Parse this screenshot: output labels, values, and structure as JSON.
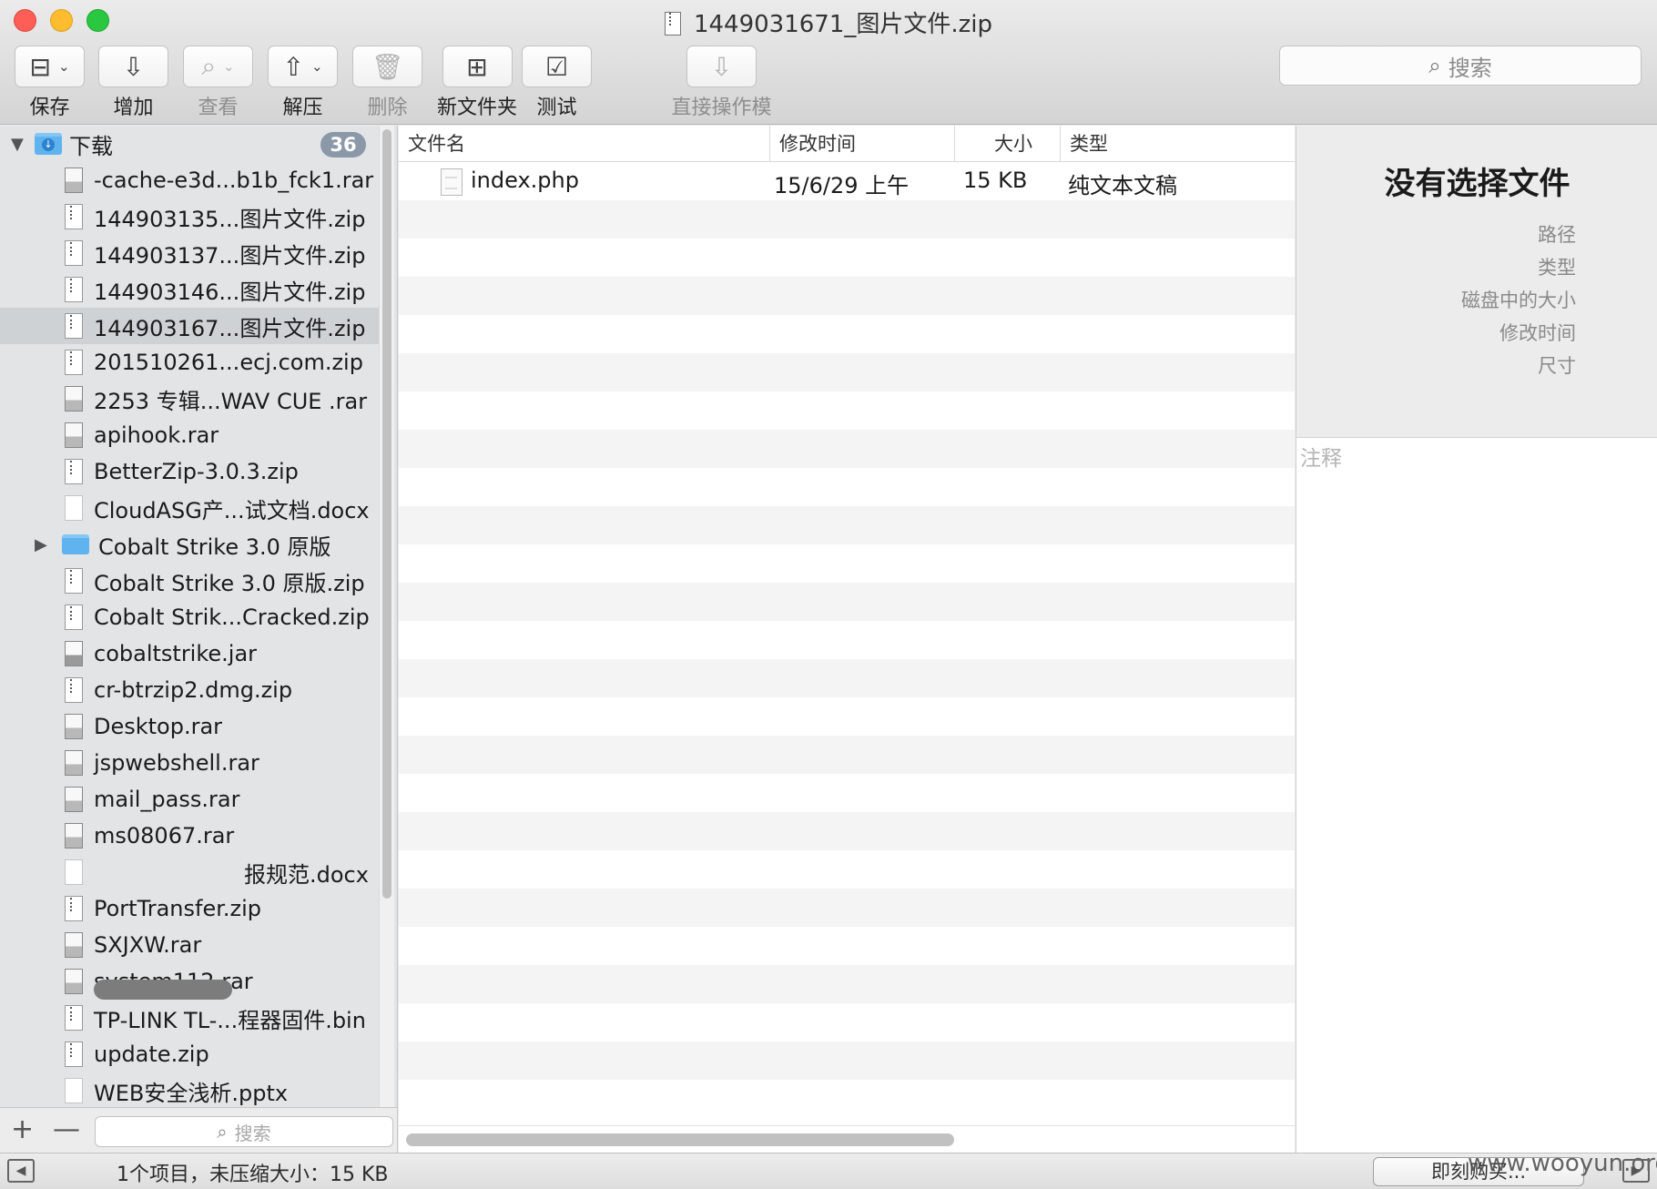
{
  "window": {
    "title": "1449031671_图片文件.zip"
  },
  "toolbar": {
    "buttons": [
      {
        "label": "保存",
        "icon": "archive-icon"
      },
      {
        "label": "增加",
        "icon": "add-box-icon"
      },
      {
        "label": "查看",
        "icon": "magnifier-icon"
      },
      {
        "label": "解压",
        "icon": "extract-icon"
      },
      {
        "label": "删除",
        "icon": "trash-icon"
      },
      {
        "label": "新文件夹",
        "icon": "new-folder-icon"
      },
      {
        "label": "测试",
        "icon": "checkmark-icon"
      },
      {
        "label": "直接操作模式",
        "icon": "direct-mode-icon"
      }
    ],
    "search_placeholder": "搜索"
  },
  "sidebar": {
    "root": {
      "label": "下载",
      "badge": "36"
    },
    "items": [
      {
        "label": "-cache-e3d...b1b_fck1.rar",
        "type": "rar"
      },
      {
        "label": "144903135...图片文件.zip",
        "type": "zip"
      },
      {
        "label": "144903137...图片文件.zip",
        "type": "zip"
      },
      {
        "label": "144903146...图片文件.zip",
        "type": "zip"
      },
      {
        "label": "144903167...图片文件.zip",
        "type": "zip",
        "selected": true
      },
      {
        "label": "201510261...ecj.com.zip",
        "type": "zip"
      },
      {
        "label": "2253 专辑...WAV CUE .rar",
        "type": "rar"
      },
      {
        "label": "apihook.rar",
        "type": "rar"
      },
      {
        "label": "BetterZip-3.0.3.zip",
        "type": "zip"
      },
      {
        "label": "CloudASG产...试文档.docx",
        "type": "doc"
      },
      {
        "label": "Cobalt Strike 3.0 原版",
        "type": "folder"
      },
      {
        "label": "Cobalt Strike 3.0 原版.zip",
        "type": "zip"
      },
      {
        "label": "Cobalt Strik...Cracked.zip",
        "type": "zip"
      },
      {
        "label": "cobaltstrike.jar",
        "type": "jar"
      },
      {
        "label": "cr-btrzip2.dmg.zip",
        "type": "zip"
      },
      {
        "label": "Desktop.rar",
        "type": "rar"
      },
      {
        "label": "jspwebshell.rar",
        "type": "rar"
      },
      {
        "label": "mail_pass.rar",
        "type": "rar"
      },
      {
        "label": "ms08067.rar",
        "type": "rar"
      },
      {
        "label": "报规范.docx",
        "type": "doc"
      },
      {
        "label": "PortTransfer.zip",
        "type": "zip"
      },
      {
        "label": "SXJXW.rar",
        "type": "rar"
      },
      {
        "label": "system112.rar",
        "type": "rar"
      },
      {
        "label": "TP-LINK TL-...程器固件.bin",
        "type": "zip"
      },
      {
        "label": "update.zip",
        "type": "zip"
      },
      {
        "label": "WEB安全浅析.pptx",
        "type": "doc"
      }
    ],
    "add_label": "+",
    "remove_label": "—",
    "search_placeholder": "搜索"
  },
  "file_list": {
    "columns": [
      "文件名",
      "修改时间",
      "大小",
      "类型"
    ],
    "rows": [
      {
        "name": "index.php",
        "modified": "15/6/29 上午",
        "size": "15 KB",
        "kind": "纯文本文稿"
      }
    ]
  },
  "info_panel": {
    "title": "没有选择文件",
    "labels": [
      "路径",
      "类型",
      "磁盘中的大小",
      "修改时间",
      "尺寸"
    ],
    "comment_placeholder": "注释"
  },
  "status": {
    "text": "1个项目，未压缩大小：15 KB",
    "buy_label": "即刻购买...",
    "watermark": "www.wooyun.org"
  }
}
